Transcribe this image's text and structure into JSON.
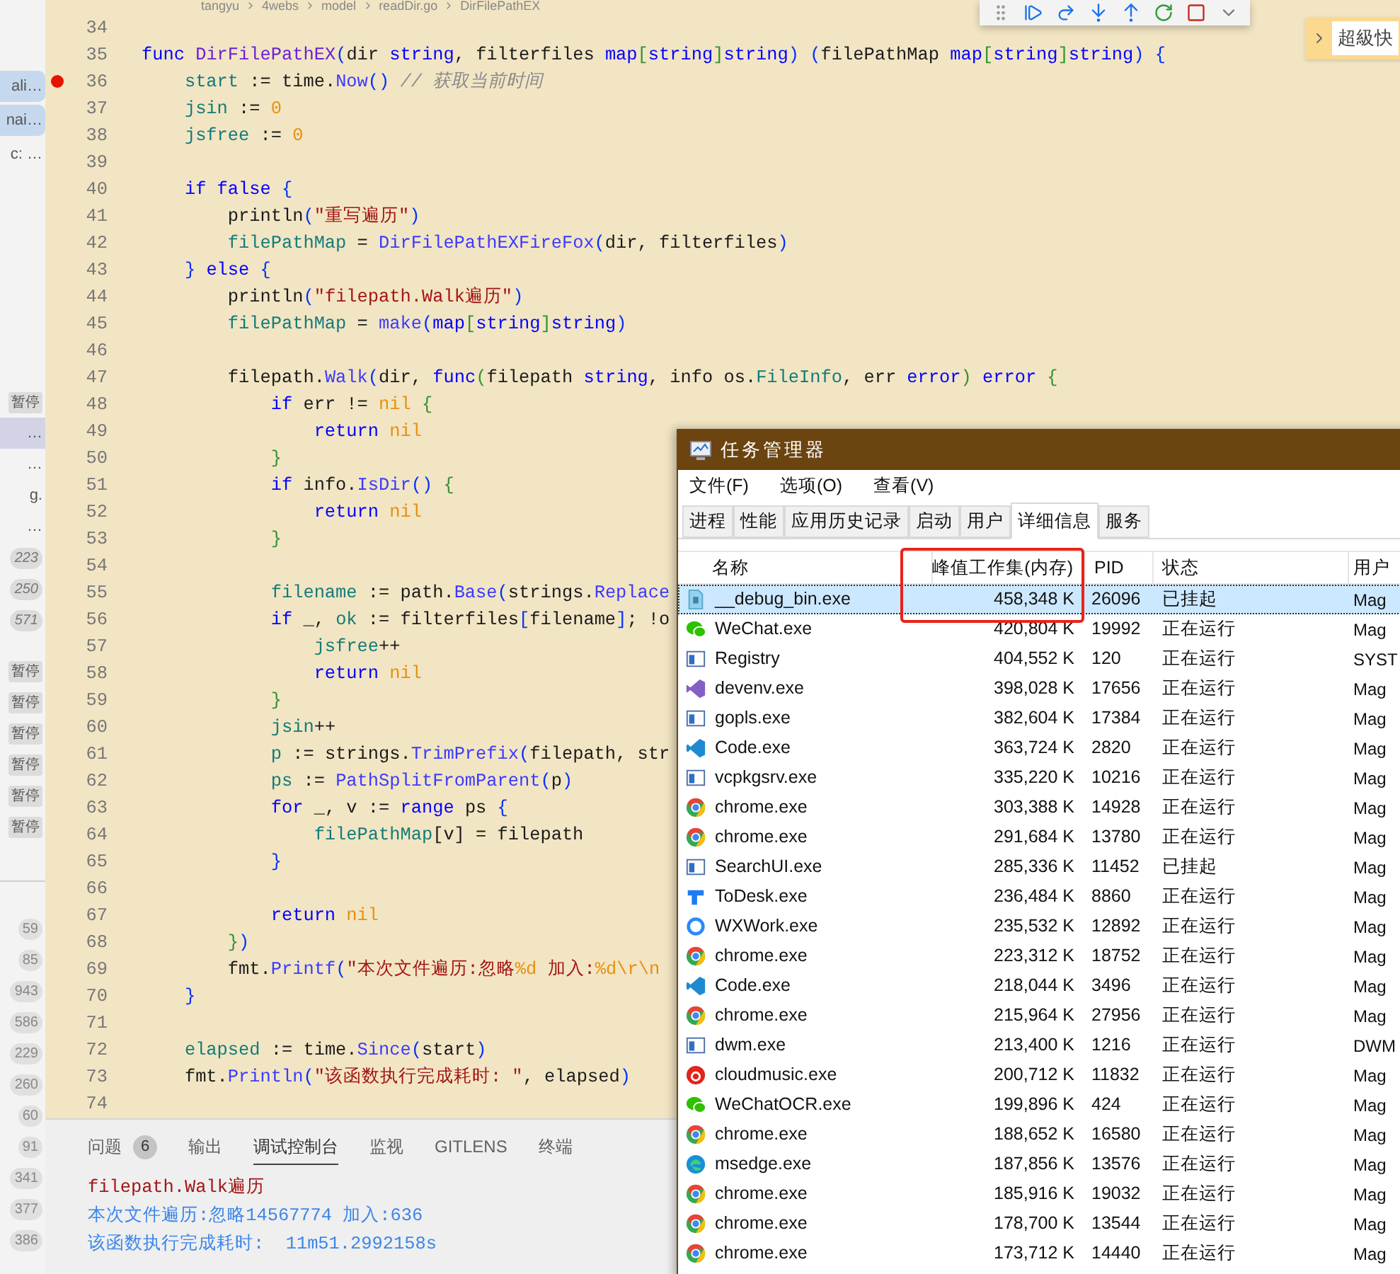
{
  "breadcrumb": [
    "tangyu",
    "4webs",
    "model",
    "readDir.go",
    "DirFilePathEX"
  ],
  "side_panel": {
    "text": "超級快"
  },
  "sidebar": {
    "top_items": [
      {
        "text": "ali…",
        "selected": true
      },
      {
        "text": "nai…",
        "selected": true
      },
      {
        "text": "c: …",
        "selected": false
      }
    ],
    "threads": [
      {
        "kind": "badge",
        "text": "暂停",
        "selected": false
      },
      {
        "kind": "text",
        "text": "…",
        "selected": true
      },
      {
        "kind": "text",
        "text": "…",
        "selected": false
      },
      {
        "kind": "text",
        "text": "g.",
        "selected": false
      },
      {
        "kind": "text",
        "text": "…",
        "selected": false
      },
      {
        "kind": "count",
        "text": "223",
        "selected": false
      },
      {
        "kind": "count",
        "text": "250",
        "selected": false
      },
      {
        "kind": "count",
        "text": "571",
        "selected": false
      }
    ],
    "frames": [
      "暂停",
      "暂停",
      "暂停",
      "暂停",
      "暂停",
      "暂停"
    ],
    "counts": [
      "59",
      "85",
      "943",
      "586",
      "229",
      "260",
      "60",
      "91",
      "341",
      "377",
      "386"
    ]
  },
  "editor": {
    "lines": [
      {
        "number": "34",
        "breakpoint": false
      },
      {
        "number": "35",
        "breakpoint": false,
        "tokens": [
          {
            "kind": "keyword",
            "text": "func "
          },
          {
            "kind": "decl",
            "text": "DirFilePathEX"
          },
          {
            "kind": "bracket",
            "text": "("
          },
          {
            "kind": "plain",
            "text": "dir "
          },
          {
            "kind": "keyword",
            "text": "string"
          },
          {
            "kind": "plain",
            "text": ", filterfiles "
          },
          {
            "kind": "keyword",
            "text": "map"
          },
          {
            "kind": "bracket2",
            "text": "["
          },
          {
            "kind": "keyword",
            "text": "string"
          },
          {
            "kind": "bracket2",
            "text": "]"
          },
          {
            "kind": "keyword",
            "text": "string"
          },
          {
            "kind": "bracket",
            "text": ") ("
          },
          {
            "kind": "plain",
            "text": "filePathMap "
          },
          {
            "kind": "keyword",
            "text": "map"
          },
          {
            "kind": "bracket2",
            "text": "["
          },
          {
            "kind": "keyword",
            "text": "string"
          },
          {
            "kind": "bracket2",
            "text": "]"
          },
          {
            "kind": "keyword",
            "text": "string"
          },
          {
            "kind": "bracket",
            "text": ") {"
          }
        ]
      },
      {
        "number": "36",
        "breakpoint": true,
        "tokens": [
          {
            "kind": "var",
            "text": "    start"
          },
          {
            "kind": "plain",
            "text": " := time."
          },
          {
            "kind": "call",
            "text": "Now"
          },
          {
            "kind": "bracket",
            "text": "()"
          },
          {
            "kind": "comment",
            "text": " // 获取当前时间"
          }
        ]
      },
      {
        "number": "37",
        "breakpoint": false,
        "tokens": [
          {
            "kind": "var",
            "text": "    jsin"
          },
          {
            "kind": "plain",
            "text": " := "
          },
          {
            "kind": "number",
            "text": "0"
          }
        ]
      },
      {
        "number": "38",
        "breakpoint": false,
        "tokens": [
          {
            "kind": "var",
            "text": "    jsfree"
          },
          {
            "kind": "plain",
            "text": " := "
          },
          {
            "kind": "number",
            "text": "0"
          }
        ]
      },
      {
        "number": "39",
        "breakpoint": false
      },
      {
        "number": "40",
        "breakpoint": false,
        "tokens": [
          {
            "kind": "keyword",
            "text": "    if false "
          },
          {
            "kind": "bracket",
            "text": "{"
          }
        ]
      },
      {
        "number": "41",
        "breakpoint": false,
        "tokens": [
          {
            "kind": "plain",
            "text": "        println"
          },
          {
            "kind": "bracket",
            "text": "("
          },
          {
            "kind": "string",
            "text": "\"重写遍历\""
          },
          {
            "kind": "bracket",
            "text": ")"
          }
        ]
      },
      {
        "number": "42",
        "breakpoint": false,
        "tokens": [
          {
            "kind": "var",
            "text": "        filePathMap"
          },
          {
            "kind": "plain",
            "text": " = "
          },
          {
            "kind": "call",
            "text": "DirFilePathEXFireFox"
          },
          {
            "kind": "bracket",
            "text": "("
          },
          {
            "kind": "plain",
            "text": "dir, filterfiles"
          },
          {
            "kind": "bracket",
            "text": ")"
          }
        ]
      },
      {
        "number": "43",
        "breakpoint": false,
        "tokens": [
          {
            "kind": "bracket",
            "text": "    }"
          },
          {
            "kind": "keyword",
            "text": " else "
          },
          {
            "kind": "bracket",
            "text": "{"
          }
        ]
      },
      {
        "number": "44",
        "breakpoint": false,
        "tokens": [
          {
            "kind": "plain",
            "text": "        println"
          },
          {
            "kind": "bracket",
            "text": "("
          },
          {
            "kind": "string",
            "text": "\"filepath.Walk遍历\""
          },
          {
            "kind": "bracket",
            "text": ")"
          }
        ]
      },
      {
        "number": "45",
        "breakpoint": false,
        "tokens": [
          {
            "kind": "var",
            "text": "        filePathMap"
          },
          {
            "kind": "plain",
            "text": " = "
          },
          {
            "kind": "call",
            "text": "make"
          },
          {
            "kind": "bracket",
            "text": "("
          },
          {
            "kind": "keyword",
            "text": "map"
          },
          {
            "kind": "bracket2",
            "text": "["
          },
          {
            "kind": "keyword",
            "text": "string"
          },
          {
            "kind": "bracket2",
            "text": "]"
          },
          {
            "kind": "keyword",
            "text": "string"
          },
          {
            "kind": "bracket",
            "text": ")"
          }
        ]
      },
      {
        "number": "46",
        "breakpoint": false
      },
      {
        "number": "47",
        "breakpoint": false,
        "tokens": [
          {
            "kind": "plain",
            "text": "        filepath."
          },
          {
            "kind": "call",
            "text": "Walk"
          },
          {
            "kind": "bracket",
            "text": "("
          },
          {
            "kind": "plain",
            "text": "dir, "
          },
          {
            "kind": "keyword",
            "text": "func"
          },
          {
            "kind": "bracket2",
            "text": "("
          },
          {
            "kind": "plain",
            "text": "filepath "
          },
          {
            "kind": "keyword",
            "text": "string"
          },
          {
            "kind": "plain",
            "text": ", info os."
          },
          {
            "kind": "var",
            "text": "FileInfo"
          },
          {
            "kind": "plain",
            "text": ", err "
          },
          {
            "kind": "keyword",
            "text": "error"
          },
          {
            "kind": "bracket2",
            "text": ")"
          },
          {
            "kind": "keyword",
            "text": " error "
          },
          {
            "kind": "bracket2",
            "text": "{"
          }
        ]
      },
      {
        "number": "48",
        "breakpoint": false,
        "tokens": [
          {
            "kind": "keyword",
            "text": "            if "
          },
          {
            "kind": "plain",
            "text": "err != "
          },
          {
            "kind": "number",
            "text": "nil "
          },
          {
            "kind": "bracket2",
            "text": "{"
          }
        ]
      },
      {
        "number": "49",
        "breakpoint": false,
        "tokens": [
          {
            "kind": "keyword",
            "text": "                return "
          },
          {
            "kind": "number",
            "text": "nil"
          }
        ]
      },
      {
        "number": "50",
        "breakpoint": false,
        "tokens": [
          {
            "kind": "bracket2",
            "text": "            }"
          }
        ]
      },
      {
        "number": "51",
        "breakpoint": false,
        "tokens": [
          {
            "kind": "keyword",
            "text": "            if "
          },
          {
            "kind": "plain",
            "text": "info."
          },
          {
            "kind": "call",
            "text": "IsDir"
          },
          {
            "kind": "bracket",
            "text": "() "
          },
          {
            "kind": "bracket2",
            "text": "{"
          }
        ]
      },
      {
        "number": "52",
        "breakpoint": false,
        "tokens": [
          {
            "kind": "keyword",
            "text": "                return "
          },
          {
            "kind": "number",
            "text": "nil"
          }
        ]
      },
      {
        "number": "53",
        "breakpoint": false,
        "tokens": [
          {
            "kind": "bracket2",
            "text": "            }"
          }
        ]
      },
      {
        "number": "54",
        "breakpoint": false
      },
      {
        "number": "55",
        "breakpoint": false,
        "tokens": [
          {
            "kind": "var",
            "text": "            filename"
          },
          {
            "kind": "plain",
            "text": " := path."
          },
          {
            "kind": "call",
            "text": "Base"
          },
          {
            "kind": "bracket",
            "text": "("
          },
          {
            "kind": "plain",
            "text": "strings."
          },
          {
            "kind": "call",
            "text": "Replace"
          }
        ]
      },
      {
        "number": "56",
        "breakpoint": false,
        "tokens": [
          {
            "kind": "keyword",
            "text": "            if "
          },
          {
            "kind": "plain",
            "text": "_, "
          },
          {
            "kind": "var",
            "text": "ok"
          },
          {
            "kind": "plain",
            "text": " := filterfiles"
          },
          {
            "kind": "bracket",
            "text": "["
          },
          {
            "kind": "plain",
            "text": "filename"
          },
          {
            "kind": "bracket",
            "text": "]"
          },
          {
            "kind": "plain",
            "text": "; !o"
          }
        ]
      },
      {
        "number": "57",
        "breakpoint": false,
        "tokens": [
          {
            "kind": "var",
            "text": "                jsfree"
          },
          {
            "kind": "plain",
            "text": "++"
          }
        ]
      },
      {
        "number": "58",
        "breakpoint": false,
        "tokens": [
          {
            "kind": "keyword",
            "text": "                return "
          },
          {
            "kind": "number",
            "text": "nil"
          }
        ]
      },
      {
        "number": "59",
        "breakpoint": false,
        "tokens": [
          {
            "kind": "bracket2",
            "text": "            }"
          }
        ]
      },
      {
        "number": "60",
        "breakpoint": false,
        "tokens": [
          {
            "kind": "var",
            "text": "            jsin"
          },
          {
            "kind": "plain",
            "text": "++"
          }
        ]
      },
      {
        "number": "61",
        "breakpoint": false,
        "tokens": [
          {
            "kind": "var",
            "text": "            p"
          },
          {
            "kind": "plain",
            "text": " := strings."
          },
          {
            "kind": "call",
            "text": "TrimPrefix"
          },
          {
            "kind": "bracket",
            "text": "("
          },
          {
            "kind": "plain",
            "text": "filepath, str"
          }
        ]
      },
      {
        "number": "62",
        "breakpoint": false,
        "tokens": [
          {
            "kind": "var",
            "text": "            ps"
          },
          {
            "kind": "plain",
            "text": " := "
          },
          {
            "kind": "call",
            "text": "PathSplitFromParent"
          },
          {
            "kind": "bracket",
            "text": "("
          },
          {
            "kind": "plain",
            "text": "p"
          },
          {
            "kind": "bracket",
            "text": ")"
          }
        ]
      },
      {
        "number": "63",
        "breakpoint": false,
        "tokens": [
          {
            "kind": "keyword",
            "text": "            for "
          },
          {
            "kind": "plain",
            "text": "_, v := "
          },
          {
            "kind": "keyword",
            "text": "range "
          },
          {
            "kind": "plain",
            "text": "ps "
          },
          {
            "kind": "bracket",
            "text": "{"
          }
        ]
      },
      {
        "number": "64",
        "breakpoint": false,
        "tokens": [
          {
            "kind": "var",
            "text": "                filePathMap"
          },
          {
            "kind": "plain",
            "text": "[v] = filepath"
          }
        ]
      },
      {
        "number": "65",
        "breakpoint": false,
        "tokens": [
          {
            "kind": "bracket",
            "text": "            }"
          }
        ]
      },
      {
        "number": "66",
        "breakpoint": false
      },
      {
        "number": "67",
        "breakpoint": false,
        "tokens": [
          {
            "kind": "keyword",
            "text": "            return "
          },
          {
            "kind": "number",
            "text": "nil"
          }
        ]
      },
      {
        "number": "68",
        "breakpoint": false,
        "tokens": [
          {
            "kind": "bracket2",
            "text": "        }"
          },
          {
            "kind": "bracket",
            "text": ")"
          }
        ]
      },
      {
        "number": "69",
        "breakpoint": false,
        "tokens": [
          {
            "kind": "plain",
            "text": "        fmt."
          },
          {
            "kind": "call",
            "text": "Printf"
          },
          {
            "kind": "bracket",
            "text": "("
          },
          {
            "kind": "string",
            "text": "\"本次文件遍历:忽略"
          },
          {
            "kind": "number",
            "text": "%d"
          },
          {
            "kind": "string",
            "text": " 加入:"
          },
          {
            "kind": "number",
            "text": "%d\\r\\n"
          }
        ]
      },
      {
        "number": "70",
        "breakpoint": false,
        "tokens": [
          {
            "kind": "bracket",
            "text": "    }"
          }
        ]
      },
      {
        "number": "71",
        "breakpoint": false
      },
      {
        "number": "72",
        "breakpoint": false,
        "tokens": [
          {
            "kind": "var",
            "text": "    elapsed"
          },
          {
            "kind": "plain",
            "text": " := time."
          },
          {
            "kind": "call",
            "text": "Since"
          },
          {
            "kind": "bracket",
            "text": "("
          },
          {
            "kind": "plain",
            "text": "start"
          },
          {
            "kind": "bracket",
            "text": ")"
          }
        ]
      },
      {
        "number": "73",
        "breakpoint": false,
        "tokens": [
          {
            "kind": "plain",
            "text": "    fmt."
          },
          {
            "kind": "call",
            "text": "Println"
          },
          {
            "kind": "bracket",
            "text": "("
          },
          {
            "kind": "string",
            "text": "\"该函数执行完成耗时: \""
          },
          {
            "kind": "plain",
            "text": ", elapsed"
          },
          {
            "kind": "bracket",
            "text": ")"
          }
        ]
      },
      {
        "number": "74",
        "breakpoint": false
      }
    ]
  },
  "panel": {
    "tabs": [
      {
        "label": "问题",
        "badge": "6",
        "selected": false
      },
      {
        "label": "输出",
        "selected": false
      },
      {
        "label": "调试控制台",
        "selected": true
      },
      {
        "label": "监视",
        "selected": false
      },
      {
        "label": "GITLENS",
        "selected": false
      },
      {
        "label": "终端",
        "selected": false
      }
    ],
    "output": [
      {
        "kind": "log",
        "text": "filepath.Walk遍历"
      },
      {
        "kind": "info",
        "text": "本次文件遍历:忽略14567774 加入:636"
      },
      {
        "kind": "info",
        "text": "该函数执行完成耗时:  11m51.2992158s"
      }
    ]
  },
  "task_manager": {
    "title": "任务管理器",
    "menu": [
      "文件(F)",
      "选项(O)",
      "查看(V)"
    ],
    "tabs": [
      {
        "label": "进程",
        "selected": false
      },
      {
        "label": "性能",
        "selected": false
      },
      {
        "label": "应用历史记录",
        "selected": false
      },
      {
        "label": "启动",
        "selected": false
      },
      {
        "label": "用户",
        "selected": false
      },
      {
        "label": "详细信息",
        "selected": true
      },
      {
        "label": "服务",
        "selected": false
      }
    ],
    "columns": [
      "名称",
      "峰值工作集(内存)",
      "PID",
      "状态",
      "用户"
    ],
    "highlight_box": true,
    "rows": [
      {
        "kind": "debug",
        "name": "__debug_bin.exe",
        "memory": "458,348 K",
        "pid": "26096",
        "status": "已挂起",
        "user": "Mag",
        "selected": true
      },
      {
        "kind": "wechat",
        "name": "WeChat.exe",
        "memory": "420,804 K",
        "pid": "19992",
        "status": "正在运行",
        "user": "Mag",
        "selected": false
      },
      {
        "kind": "app",
        "name": "Registry",
        "memory": "404,552 K",
        "pid": "120",
        "status": "正在运行",
        "user": "SYST",
        "selected": false
      },
      {
        "kind": "vs",
        "name": "devenv.exe",
        "memory": "398,028 K",
        "pid": "17656",
        "status": "正在运行",
        "user": "Mag",
        "selected": false
      },
      {
        "kind": "app",
        "name": "gopls.exe",
        "memory": "382,604 K",
        "pid": "17384",
        "status": "正在运行",
        "user": "Mag",
        "selected": false
      },
      {
        "kind": "vscode",
        "name": "Code.exe",
        "memory": "363,724 K",
        "pid": "2820",
        "status": "正在运行",
        "user": "Mag",
        "selected": false
      },
      {
        "kind": "app",
        "name": "vcpkgsrv.exe",
        "memory": "335,220 K",
        "pid": "10216",
        "status": "正在运行",
        "user": "Mag",
        "selected": false
      },
      {
        "kind": "chrome",
        "name": "chrome.exe",
        "memory": "303,388 K",
        "pid": "14928",
        "status": "正在运行",
        "user": "Mag",
        "selected": false
      },
      {
        "kind": "chrome",
        "name": "chrome.exe",
        "memory": "291,684 K",
        "pid": "13780",
        "status": "正在运行",
        "user": "Mag",
        "selected": false
      },
      {
        "kind": "app",
        "name": "SearchUI.exe",
        "memory": "285,336 K",
        "pid": "11452",
        "status": "已挂起",
        "user": "Mag",
        "selected": false
      },
      {
        "kind": "todesk",
        "name": "ToDesk.exe",
        "memory": "236,484 K",
        "pid": "8860",
        "status": "正在运行",
        "user": "Mag",
        "selected": false
      },
      {
        "kind": "wxwork",
        "name": "WXWork.exe",
        "memory": "235,532 K",
        "pid": "12892",
        "status": "正在运行",
        "user": "Mag",
        "selected": false
      },
      {
        "kind": "chrome",
        "name": "chrome.exe",
        "memory": "223,312 K",
        "pid": "18752",
        "status": "正在运行",
        "user": "Mag",
        "selected": false
      },
      {
        "kind": "vscode",
        "name": "Code.exe",
        "memory": "218,044 K",
        "pid": "3496",
        "status": "正在运行",
        "user": "Mag",
        "selected": false
      },
      {
        "kind": "chrome",
        "name": "chrome.exe",
        "memory": "215,964 K",
        "pid": "27956",
        "status": "正在运行",
        "user": "Mag",
        "selected": false
      },
      {
        "kind": "app",
        "name": "dwm.exe",
        "memory": "213,400 K",
        "pid": "1216",
        "status": "正在运行",
        "user": "DWM",
        "selected": false
      },
      {
        "kind": "music",
        "name": "cloudmusic.exe",
        "memory": "200,712 K",
        "pid": "11832",
        "status": "正在运行",
        "user": "Mag",
        "selected": false
      },
      {
        "kind": "wechat",
        "name": "WeChatOCR.exe",
        "memory": "199,896 K",
        "pid": "424",
        "status": "正在运行",
        "user": "Mag",
        "selected": false
      },
      {
        "kind": "chrome",
        "name": "chrome.exe",
        "memory": "188,652 K",
        "pid": "16580",
        "status": "正在运行",
        "user": "Mag",
        "selected": false
      },
      {
        "kind": "edge",
        "name": "msedge.exe",
        "memory": "187,856 K",
        "pid": "13576",
        "status": "正在运行",
        "user": "Mag",
        "selected": false
      },
      {
        "kind": "chrome",
        "name": "chrome.exe",
        "memory": "185,916 K",
        "pid": "19032",
        "status": "正在运行",
        "user": "Mag",
        "selected": false
      },
      {
        "kind": "chrome",
        "name": "chrome.exe",
        "memory": "178,700 K",
        "pid": "13544",
        "status": "正在运行",
        "user": "Mag",
        "selected": false
      },
      {
        "kind": "chrome",
        "name": "chrome.exe",
        "memory": "173,712 K",
        "pid": "14440",
        "status": "正在运行",
        "user": "Mag",
        "selected": false
      }
    ]
  }
}
